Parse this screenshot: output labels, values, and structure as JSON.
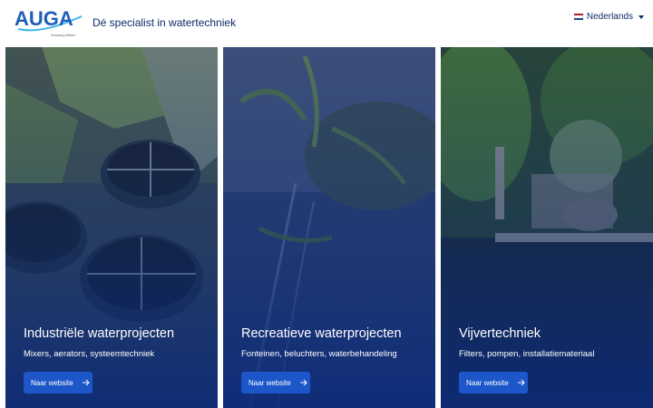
{
  "header": {
    "logo_text": "AUGA",
    "logo_sub": "Amazing Water",
    "tagline": "Dé specialist in watertechniek",
    "language": {
      "label": "Nederlands",
      "flag_colors": [
        "#ae1c28",
        "#ffffff",
        "#21468b"
      ]
    }
  },
  "colors": {
    "brand": "#1f5fb8",
    "navy": "#0d2a6b",
    "button": "#1c56c8",
    "overlay": "#0b2a7a"
  },
  "cards": [
    {
      "title": "Industriële waterprojecten",
      "subtitle": "Mixers, aerators, systeemtechniek",
      "button_label": "Naar website",
      "button_icon": "arrow-right-icon",
      "image": "industrial-water-treatment-tanks-aerial"
    },
    {
      "title": "Recreatieve waterprojecten",
      "subtitle": "Fonteinen, beluchters, waterbehandeling",
      "button_label": "Naar website",
      "button_icon": "arrow-right-icon",
      "image": "fountain-with-plants"
    },
    {
      "title": "Vijvertechniek",
      "subtitle": "Filters, pompen, installatiemateriaal",
      "button_label": "Naar website",
      "button_icon": "arrow-right-icon",
      "image": "garden-pond-with-trees"
    }
  ]
}
